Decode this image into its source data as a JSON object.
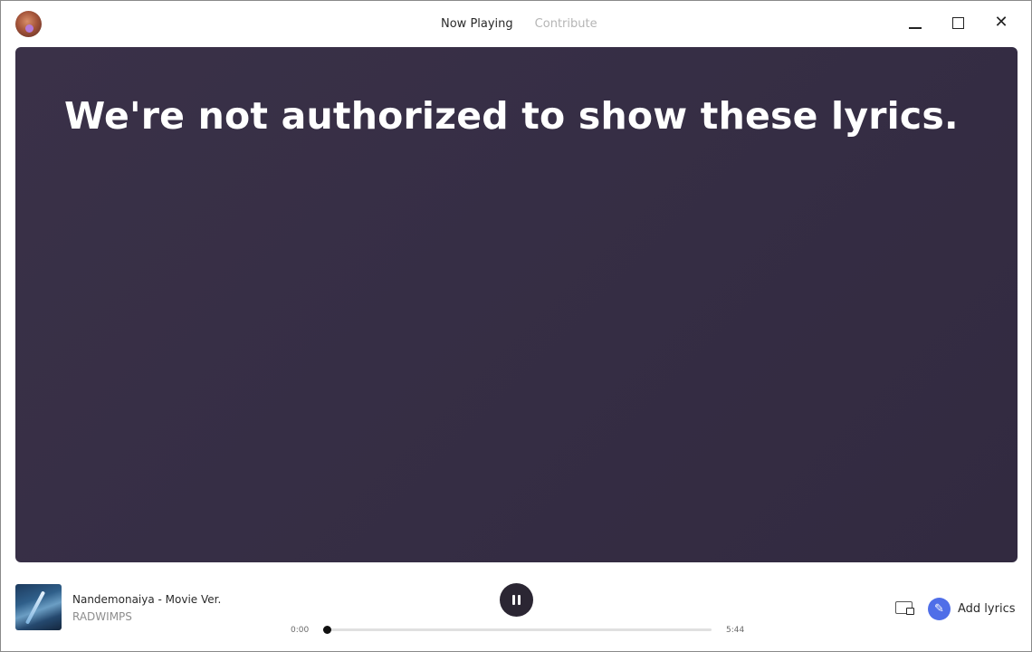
{
  "nav": {
    "tabs": [
      {
        "label": "Now Playing",
        "active": true
      },
      {
        "label": "Contribute",
        "active": false
      }
    ]
  },
  "window_controls": {
    "minimize_icon": "minimize-icon",
    "maximize_icon": "maximize-icon",
    "close_icon": "close-icon",
    "close_glyph": "✕"
  },
  "lyrics": {
    "message": "We're not authorized to show these lyrics."
  },
  "player": {
    "track_title": "Nandemonaiya - Movie Ver.",
    "artist": "RADWIMPS",
    "state": "playing",
    "time_current": "0:00",
    "time_total": "5:44",
    "progress_fraction": 0.01,
    "add_lyrics_label": "Add lyrics",
    "add_lyrics_glyph": "✎"
  },
  "colors": {
    "panel_bg": "#362e45",
    "play_button": "#2b2633",
    "accent_blue": "#4f6ee8"
  }
}
